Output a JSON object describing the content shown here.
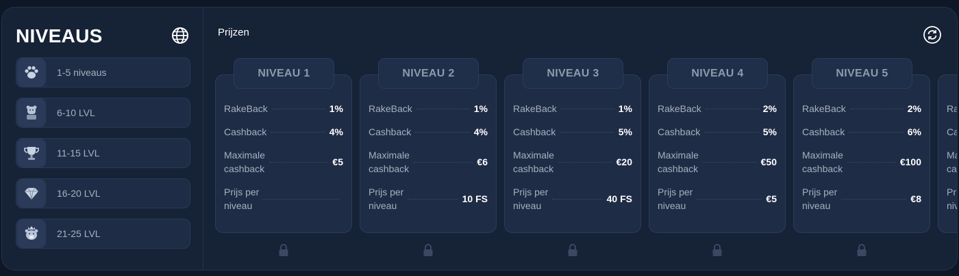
{
  "sidebar": {
    "title": "NIVEAUS",
    "items": [
      {
        "label": "1-5 niveaus",
        "icon": "paw-icon"
      },
      {
        "label": "6-10 LVL",
        "icon": "bear-bust-icon"
      },
      {
        "label": "11-15 LVL",
        "icon": "trophy-icon"
      },
      {
        "label": "16-20 LVL",
        "icon": "diamond-icon"
      },
      {
        "label": "21-25 LVL",
        "icon": "crowned-bear-icon"
      }
    ]
  },
  "main": {
    "title": "Prijzen",
    "row_labels": {
      "rakeback": "RakeBack",
      "cashback": "Cashback",
      "max_cashback_1": "Maximale",
      "max_cashback_2": "cashback",
      "prize_1": "Prijs per",
      "prize_2": "niveau"
    },
    "cards": [
      {
        "title": "NIVEAU 1",
        "rakeback": "1%",
        "cashback": "4%",
        "max_cashback": "€5",
        "prize": ""
      },
      {
        "title": "NIVEAU 2",
        "rakeback": "1%",
        "cashback": "4%",
        "max_cashback": "€6",
        "prize": "10 FS"
      },
      {
        "title": "NIVEAU 3",
        "rakeback": "1%",
        "cashback": "5%",
        "max_cashback": "€20",
        "prize": "40 FS"
      },
      {
        "title": "NIVEAU 4",
        "rakeback": "2%",
        "cashback": "5%",
        "max_cashback": "€50",
        "prize": "€5"
      },
      {
        "title": "NIVEAU 5",
        "rakeback": "2%",
        "cashback": "6%",
        "max_cashback": "€100",
        "prize": "€8"
      }
    ],
    "partial_card": {
      "rakeback": "Ra",
      "cashback": "Ca",
      "max_1": "Ma",
      "max_2": "ca",
      "prize_1": "Pr",
      "prize_2": "niv"
    }
  },
  "colors": {
    "background": "#0d1726",
    "panel": "#162236",
    "card": "#1e2c45",
    "muted_text": "#a7b0c0"
  }
}
